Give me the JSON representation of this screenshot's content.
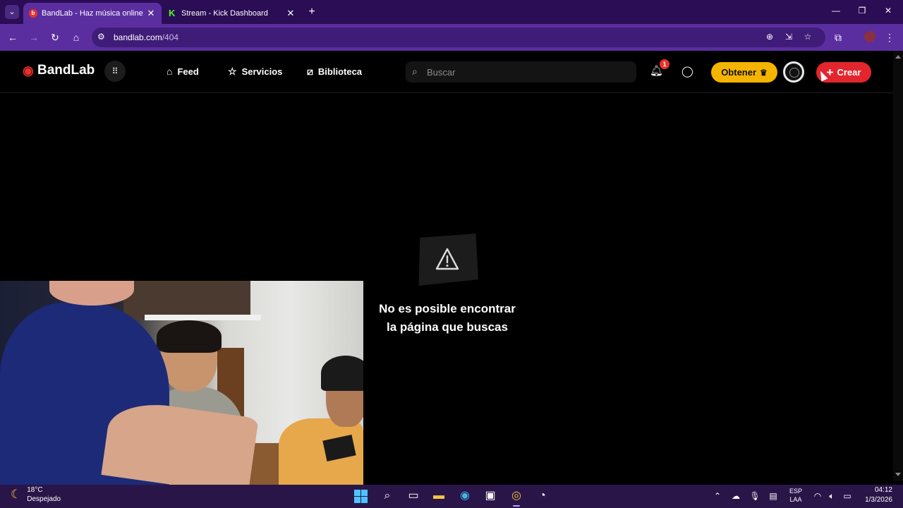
{
  "browser": {
    "tabs": [
      {
        "title": "BandLab - Haz música online",
        "active": true,
        "favicon": "bandlab-icon"
      },
      {
        "title": "Stream - Kick Dashboard",
        "active": false,
        "favicon": "kick-icon"
      }
    ],
    "url_host": "bandlab.com",
    "url_path": "/404"
  },
  "header": {
    "logo_text": "BandLab",
    "nav": [
      {
        "label": "Feed",
        "icon": "home-icon"
      },
      {
        "label": "Servicios",
        "icon": "star-icon"
      },
      {
        "label": "Biblioteca",
        "icon": "library-icon"
      }
    ],
    "search_placeholder": "Buscar",
    "notifications_count": "1",
    "get_label": "Obtener",
    "create_label": "Crear"
  },
  "error": {
    "line1": "No es posible encontrar",
    "line2": "la página que buscas"
  },
  "taskbar": {
    "temperature": "18°C",
    "weather": "Despejado",
    "lang_top": "ESP",
    "lang_bottom": "LAA",
    "time": "04:12",
    "date": "1/3/2026"
  },
  "colors": {
    "bandlab_red": "#e3262e",
    "obtener_yellow": "#f5b400",
    "browser_purple": "#5b2ea0"
  }
}
